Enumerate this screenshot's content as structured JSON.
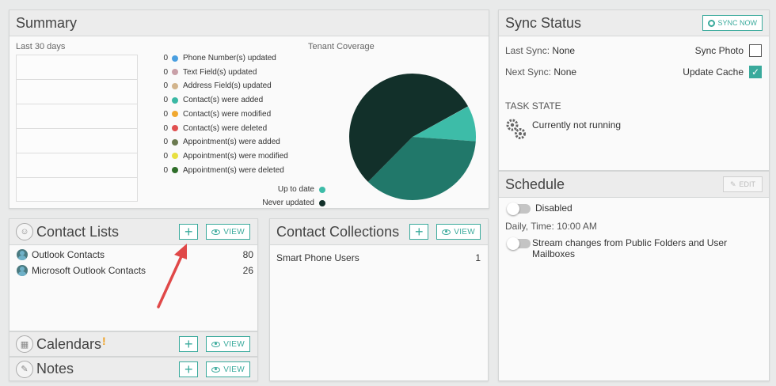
{
  "summary": {
    "title": "Summary",
    "period": "Last 30 days",
    "coverage_title": "Tenant Coverage",
    "legend": [
      {
        "count": "0",
        "label": "Phone Number(s) updated",
        "color": "#4a9fe0"
      },
      {
        "count": "0",
        "label": "Text Field(s) updated",
        "color": "#c9a0a8"
      },
      {
        "count": "0",
        "label": "Address Field(s) updated",
        "color": "#d2b48c"
      },
      {
        "count": "0",
        "label": "Contact(s) were added",
        "color": "#3ab8a4"
      },
      {
        "count": "0",
        "label": "Contact(s) were modified",
        "color": "#f0a830"
      },
      {
        "count": "0",
        "label": "Contact(s) were deleted",
        "color": "#e05050"
      },
      {
        "count": "0",
        "label": "Appointment(s) were added",
        "color": "#6b7a50"
      },
      {
        "count": "0",
        "label": "Appointment(s) were modified",
        "color": "#e8e040"
      },
      {
        "count": "0",
        "label": "Appointment(s) were deleted",
        "color": "#2f6e2a"
      }
    ],
    "status": [
      {
        "label": "Up to date",
        "color": "#3dbca8"
      },
      {
        "label": "Never updated",
        "color": "#12302a"
      }
    ],
    "pie_colors": [
      "#12302a",
      "#3dbca8",
      "#21786a"
    ]
  },
  "sync": {
    "title": "Sync Status",
    "sync_now": "SYNC NOW",
    "last_sync_label": "Last Sync:",
    "last_sync_value": "None",
    "next_sync_label": "Next Sync:",
    "next_sync_value": "None",
    "sync_photo": "Sync Photo",
    "update_cache": "Update Cache",
    "task_state": "TASK STATE",
    "task_status": "Currently not running"
  },
  "schedule": {
    "title": "Schedule",
    "edit": "EDIT",
    "disabled": "Disabled",
    "time": "Daily, Time: 10:00 AM",
    "stream": "Stream changes from Public Folders and User Mailboxes"
  },
  "contact_lists": {
    "title": "Contact Lists",
    "add": "+",
    "view": "VIEW",
    "items": [
      {
        "name": "Outlook Contacts",
        "count": "80"
      },
      {
        "name": "Microsoft Outlook Contacts",
        "count": "26"
      }
    ]
  },
  "contact_collections": {
    "title": "Contact Collections",
    "add": "+",
    "view": "VIEW",
    "items": [
      {
        "name": "Smart Phone Users",
        "count": "1"
      }
    ]
  },
  "calendars": {
    "title": "Calendars",
    "badge": "!",
    "add": "+",
    "view": "VIEW"
  },
  "notes": {
    "title": "Notes",
    "add": "+",
    "view": "VIEW"
  }
}
